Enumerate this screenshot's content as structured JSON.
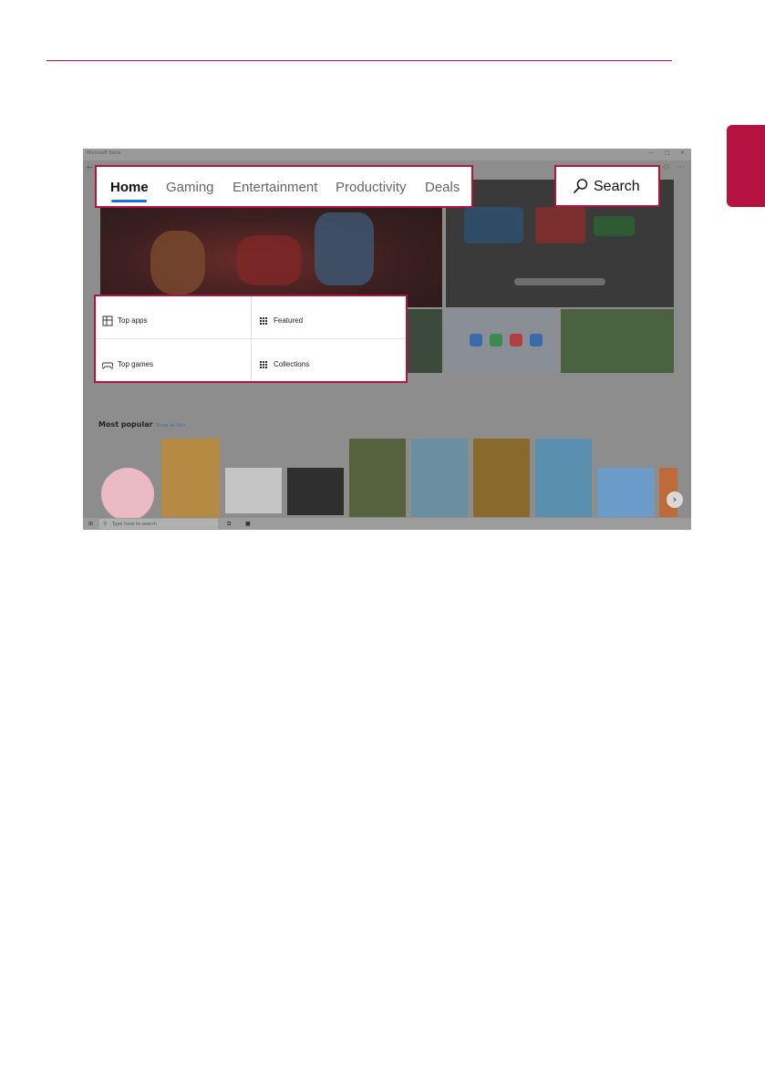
{
  "screenshot": {
    "window_title": "Microsoft Store",
    "window_controls": [
      "—",
      "□",
      "✕"
    ],
    "nav_tabs": [
      "Home",
      "Gaming",
      "Entertainment",
      "Productivity",
      "Deals"
    ],
    "active_tab": "Home",
    "search_label": "Search",
    "quick_links": {
      "top_apps": "Top apps",
      "featured": "Featured",
      "top_games": "Top games",
      "collections": "Collections"
    },
    "section_title": "Most popular",
    "show_all": "Show all 99+",
    "taskbar_search": "Type here to search",
    "next_arrow": "›"
  },
  "colors": {
    "accent": "#b5123f",
    "tab_underline": "#1a6fd8",
    "overlay_gray": "#8d8d8d"
  }
}
